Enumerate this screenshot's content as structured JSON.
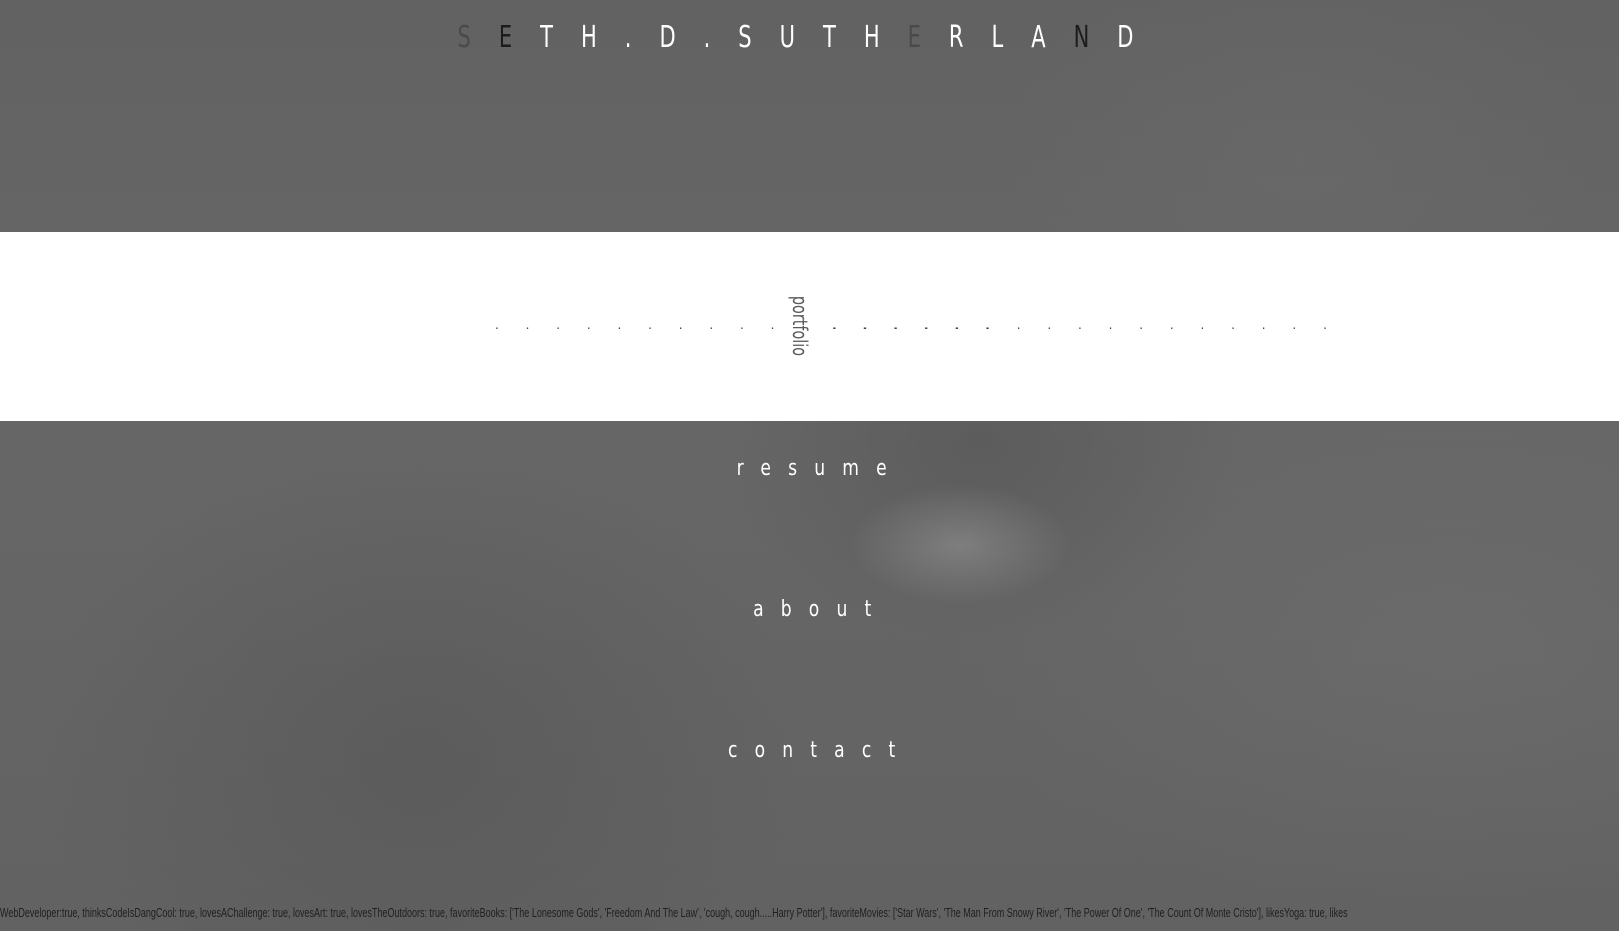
{
  "header": {
    "title_chars": [
      "S",
      "E",
      "T",
      "H",
      ".",
      "D",
      ".",
      "S",
      "U",
      "T",
      "H",
      "E",
      "R",
      "L",
      "A",
      "N",
      "D"
    ],
    "title_colors": [
      "#4a4a4a",
      "#1c1c1c",
      "#ffffff",
      "#ffffff",
      "#ffffff",
      "#ffffff",
      "#ffffff",
      "#ffffff",
      "#ffffff",
      "#ffffff",
      "#ffffff",
      "#4a4a4a",
      "#ffffff",
      "#ffffff",
      "#ffffff",
      "#1c1c1c",
      "#ffffff"
    ]
  },
  "nav": {
    "active_label": "portfolio",
    "dots_left": ". . . . . . . . . . . . . . . . .",
    "dots_right": ". . . . . . . . . . . . . . . . .",
    "resume_label": "resume",
    "about_label": "about",
    "contact_label": "contact"
  },
  "footer": {
    "ticker_text": "WebDeveloper:true, thinksCodeIsDangCool: true, lovesAChallenge: true, lovesArt: true, lovesTheOutdoors: true, favoriteBooks: ['The Lonesome Gods', 'Freedom And The Law', 'cough, cough.....Harry Potter'], favoriteMovies: ['Star Wars', 'The Man From Snowy River', 'The Power Of One', 'The Count Of Monte Cristo'], likesYoga: true, likes"
  },
  "colors": {
    "background": "#646464",
    "band": "#ffffff",
    "nav_text": "#ffffff",
    "active_text": "#5a5a5a",
    "ticker_text": "#202020"
  }
}
